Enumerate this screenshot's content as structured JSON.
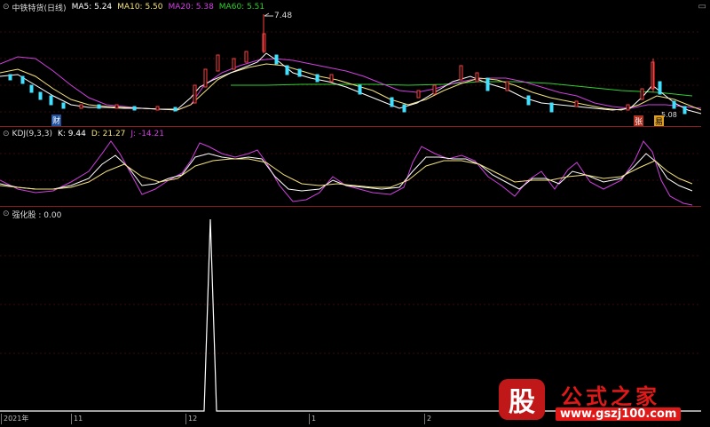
{
  "top_panel": {
    "title": "中铁特货(日线)",
    "ma5": "MA5: 5.24",
    "ma10": "MA10: 5.50",
    "ma20": "MA20: 5.38",
    "ma60": "MA60: 5.51",
    "high_label": "7.48",
    "low_label": "5.08",
    "marker_cai": "财",
    "marker_zhang": "张",
    "marker_yang": "易"
  },
  "kdj_panel": {
    "title": "KDJ(9,3,3)",
    "k": "K: 9.44",
    "d": "D: 21.27",
    "j": "J: -14.21"
  },
  "strong_panel": {
    "title": "强化股 : 0.00"
  },
  "time_axis": {
    "labels": [
      "2021年",
      "11",
      "12",
      "1",
      "2"
    ]
  },
  "watermark": {
    "logo": "股",
    "brand": "公式之家",
    "url": "www.gszj100.com"
  },
  "colors": {
    "ma5": "#ffffff",
    "ma10": "#f3e37c",
    "ma20": "#d040e0",
    "ma60": "#30d030",
    "up": "#ff4040",
    "down": "#40e0ff",
    "separator": "#8b1a1a"
  },
  "icons": [
    "circle-icon",
    "window-icon"
  ]
}
